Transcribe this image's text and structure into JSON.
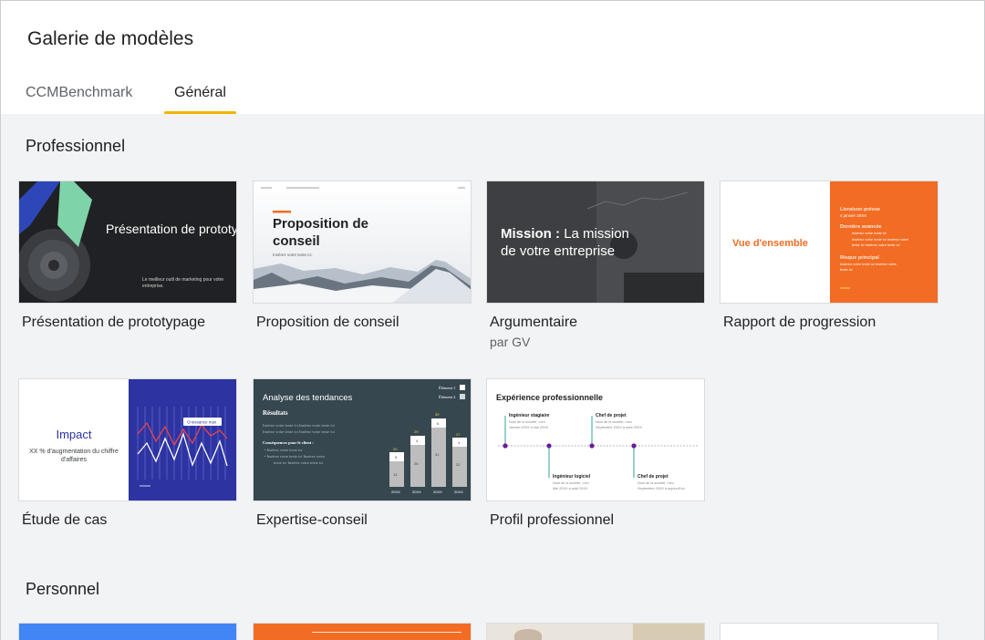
{
  "dialog": {
    "title": "Galerie de modèles"
  },
  "tabs": [
    {
      "label": "CCMBenchmark",
      "active": false
    },
    {
      "label": "Général",
      "active": true
    }
  ],
  "sections": {
    "professional": {
      "title": "Professionnel",
      "templates": [
        {
          "name": "Présentation de prototypage",
          "thumb_text": "Présentation de prototypage",
          "thumb_sub": "Le meilleur outil de marketing pour votre entreprise."
        },
        {
          "name": "Proposition de conseil",
          "thumb_text": "Proposition de conseil",
          "thumb_sub": "Insérez votre texte ici."
        },
        {
          "name": "Argumentaire",
          "author": "par GV",
          "thumb_bold": "Mission :",
          "thumb_text_1": "La mission",
          "thumb_text_2": "de votre entreprise"
        },
        {
          "name": "Rapport de progression",
          "thumb_text": "Vue d'ensemble",
          "thumb_items": [
            "Livraison prévue",
            "Dernière avancée",
            "Risque principal"
          ]
        },
        {
          "name": "Étude de cas",
          "thumb_title": "Impact",
          "thumb_sub_1": "XX % d'augmentation du chiffre",
          "thumb_sub_2": "d'affaires",
          "thumb_tag": "Croissance max"
        },
        {
          "name": "Expertise-conseil",
          "thumb_title": "Analyse des tendances",
          "thumb_sub": "Résultats",
          "thumb_legend": [
            "Élément 1",
            "Élément 2"
          ]
        },
        {
          "name": "Profil professionnel",
          "thumb_title": "Expérience professionnelle",
          "thumb_roles": [
            "Ingénieur stagiaire",
            "Chef de projet",
            "Ingénieur logiciel",
            "Chef de projet"
          ]
        }
      ]
    },
    "personal": {
      "title": "Personnel"
    }
  },
  "colors": {
    "accent_tab": "#f4b400",
    "orange": "#f26c23",
    "navy": "#2d33a0",
    "dark_slate": "#37474f",
    "blue": "#4285f4"
  }
}
